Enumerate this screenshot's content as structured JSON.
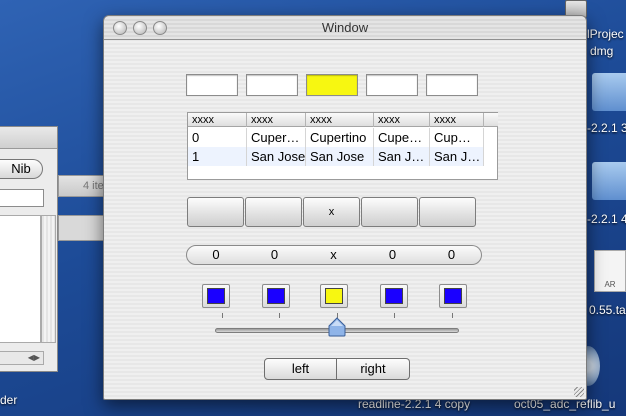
{
  "window": {
    "title": "Window"
  },
  "text_fields": [
    {
      "value": "",
      "highlight": false
    },
    {
      "value": "",
      "highlight": false
    },
    {
      "value": "",
      "highlight": true
    },
    {
      "value": "",
      "highlight": false
    },
    {
      "value": "",
      "highlight": false
    }
  ],
  "table": {
    "headers": [
      "xxxx",
      "xxxx",
      "xxxx",
      "xxxx",
      "xxxx"
    ],
    "rows": [
      [
        "0",
        "Cuper…",
        "Cupertino",
        "Cupe…",
        "Cup…"
      ],
      [
        "1",
        "San Jose",
        "San Jose",
        "San J…",
        "San J…"
      ]
    ]
  },
  "buttons_row": [
    "",
    "",
    "x",
    "",
    ""
  ],
  "segment_labels": [
    "0",
    "0",
    "x",
    "0",
    "0"
  ],
  "color_wells": [
    "#1a00ff",
    "#1a00ff",
    "#f7f711",
    "#1a00ff",
    "#1a00ff"
  ],
  "slider": {
    "fraction": 0.5
  },
  "nav_buttons": {
    "left": "left",
    "right": "right"
  },
  "back_window": {
    "button_label": "Nib",
    "count_text": "4 ite"
  },
  "desktop": {
    "label_top": "lProjec",
    "label_dmg": "dmg",
    "label_v1": "-2.2.1 3",
    "label_v2": "-2.2.1 4",
    "label_tar": "0.55.ta",
    "label_folder": "der",
    "label_readline": "readline-2.2.1 4 copy",
    "label_oct": "oct05_adc_reflib_u"
  },
  "colors": {
    "highlight": "#f7f711",
    "swatch_blue": "#1a00ff"
  }
}
